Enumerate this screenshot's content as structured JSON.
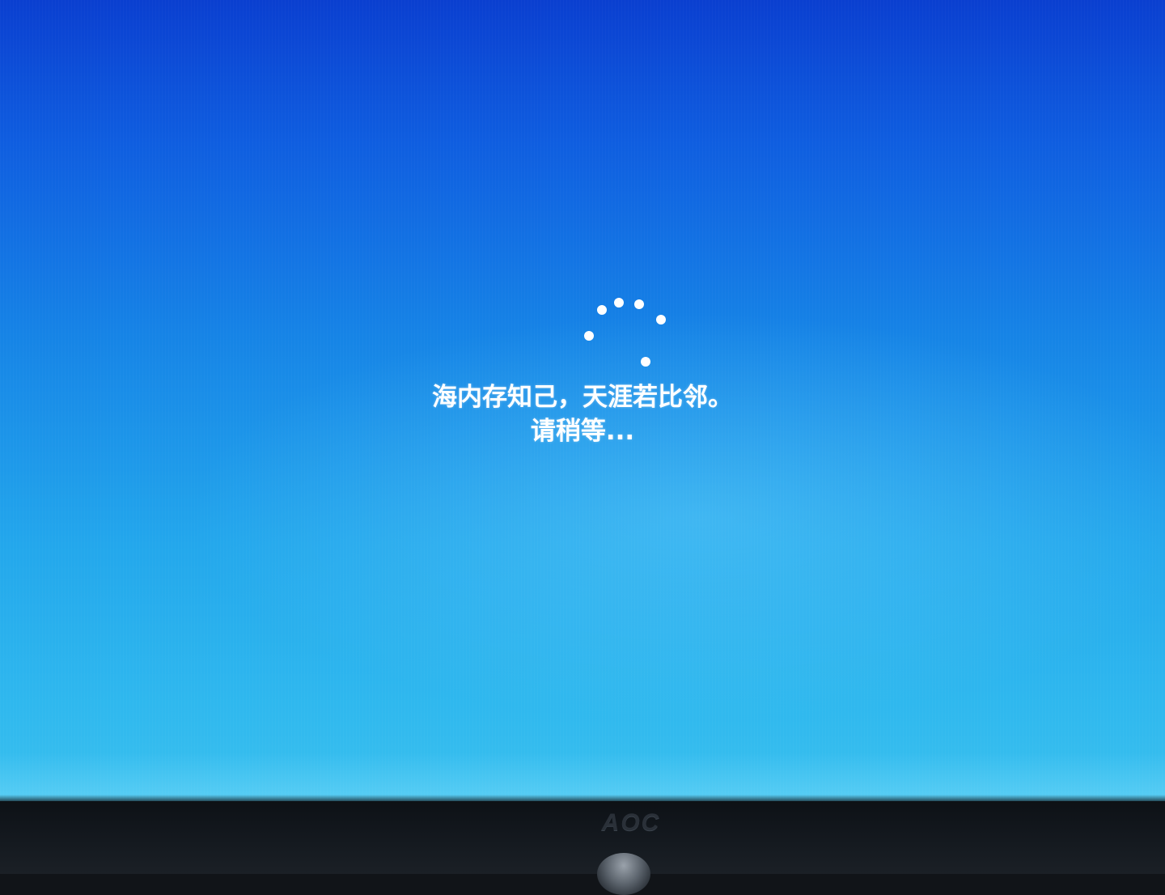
{
  "setup_screen": {
    "message_line_1": "海内存知己，天涯若比邻。",
    "message_line_2": "请稍等..."
  },
  "spinner": {
    "icon": "loading-spinner-icon",
    "dot_count": 6
  },
  "monitor": {
    "brand_logo": "AOC"
  },
  "colors": {
    "background_top": "#0a3fd0",
    "background_bottom": "#3ac0ef",
    "text": "#ffffff",
    "bezel": "#111418"
  }
}
